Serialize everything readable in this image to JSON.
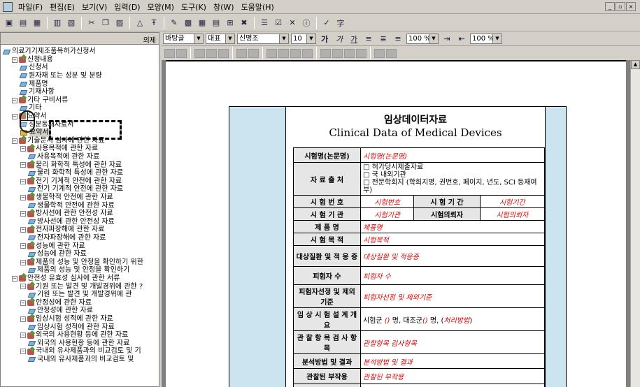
{
  "menu": {
    "items": [
      "파일(F)",
      "편집(E)",
      "보기(V)",
      "입력(D)",
      "모양(M)",
      "도구(K)",
      "창(W)",
      "도움말(H)"
    ],
    "window_buttons": [
      "_",
      "▫",
      "×"
    ]
  },
  "format_bar": {
    "style": "바탕글",
    "size_label": "대표",
    "font": "신명조",
    "font_size": "10",
    "zoom1": "100 %",
    "zoom2": "100 %",
    "bold": "가",
    "italic": "가",
    "underline": "가"
  },
  "left_pane": {
    "header_label": "의제"
  },
  "tree": [
    {
      "level": 0,
      "kind": "page",
      "label": "의료기기제조품목허가신청서"
    },
    {
      "level": 1,
      "kind": "book",
      "label": "신청내용"
    },
    {
      "level": 2,
      "kind": "page",
      "label": "신청서"
    },
    {
      "level": 2,
      "kind": "page",
      "label": "원자재 또는 성분 및 분량"
    },
    {
      "level": 2,
      "kind": "page",
      "label": "제품명"
    },
    {
      "level": 2,
      "kind": "page",
      "label": "기재사항"
    },
    {
      "level": 1,
      "kind": "book",
      "label": "기타 구비서류"
    },
    {
      "level": 2,
      "kind": "page",
      "label": "기타"
    },
    {
      "level": 1,
      "kind": "book",
      "label": "요약서"
    },
    {
      "level": 2,
      "kind": "page",
      "label": "성분동재자료서"
    },
    {
      "level": 2,
      "kind": "folder",
      "label": "요약서"
    },
    {
      "level": 1,
      "kind": "book",
      "label": "기술문서 심사에 관한 자료"
    },
    {
      "level": 2,
      "kind": "book",
      "label": "사용목적에 관한 자료"
    },
    {
      "level": 3,
      "kind": "page",
      "label": "사용목적에 관한 자료"
    },
    {
      "level": 2,
      "kind": "book",
      "label": "물리 화학적 특성에 관한 자료"
    },
    {
      "level": 3,
      "kind": "page",
      "label": "물리 화학적 특성에 관한 자료"
    },
    {
      "level": 2,
      "kind": "book",
      "label": "전기 기계적 안전에 관한 자료"
    },
    {
      "level": 3,
      "kind": "page",
      "label": "전기 기계적 안전에 관한 자료"
    },
    {
      "level": 2,
      "kind": "book",
      "label": "생물학적 안전에 관한 자료"
    },
    {
      "level": 3,
      "kind": "page",
      "label": "생물학적 안전에 관한 자료"
    },
    {
      "level": 2,
      "kind": "book",
      "label": "방사선에 관한 안전성 자료"
    },
    {
      "level": 3,
      "kind": "page",
      "label": "방사선에 관한 안전성 자료"
    },
    {
      "level": 2,
      "kind": "book",
      "label": "전자파장해에 관한 자료"
    },
    {
      "level": 3,
      "kind": "page",
      "label": "전자파장해에 관한 자료"
    },
    {
      "level": 2,
      "kind": "book",
      "label": "성능에 관한 자료"
    },
    {
      "level": 3,
      "kind": "page",
      "label": "성능에 관한 자료"
    },
    {
      "level": 2,
      "kind": "book",
      "label": "제품의 성능 및 안정을 확인하기 위한"
    },
    {
      "level": 3,
      "kind": "page",
      "label": "제품의 성능 및 안정을 확인하기"
    },
    {
      "level": 1,
      "kind": "book",
      "label": "안전성 유효성 심사에 관한 서류"
    },
    {
      "level": 2,
      "kind": "book",
      "label": "기원 또는 발견 및 개발경위에 관한 ?"
    },
    {
      "level": 3,
      "kind": "page",
      "label": "기원 또는 발견 및 개발경위에 관"
    },
    {
      "level": 2,
      "kind": "book",
      "label": "안정성에 관한 자료"
    },
    {
      "level": 3,
      "kind": "page",
      "label": "안정성에 관한 자료"
    },
    {
      "level": 2,
      "kind": "book",
      "label": "임상시험 성적에 관한 자료"
    },
    {
      "level": 3,
      "kind": "page",
      "label": "임상시험 성적에 관한 자료"
    },
    {
      "level": 2,
      "kind": "book",
      "label": "외국의 사용현황 등에 관한 자료"
    },
    {
      "level": 3,
      "kind": "page",
      "label": "외국의 사용현황 등에 관한 자료"
    },
    {
      "level": 2,
      "kind": "book",
      "label": "국내외 유사제품과의 비교검토 및 기"
    },
    {
      "level": 3,
      "kind": "page",
      "label": "국내외 유사제품과의 비교검토 및"
    }
  ],
  "document": {
    "title_ko": "임상데이터자료",
    "title_en": "Clinical Data of Medical Devices",
    "rows": {
      "trial_name_k": "시험명(논문명)",
      "trial_name_v": "시험명(논문명)",
      "source_k": "자 료 출 처",
      "source_opts": [
        "□ 허가당시제출자료",
        "□ 국 내외기관",
        "□ 전문학회지 (학회지명, 권번호, 페이지, 년도, SCI 등재여부)"
      ],
      "trial_no_k": "시 험 번 호",
      "trial_no_v": "시험번호",
      "trial_period_k": "시 험 기 간",
      "trial_period_v": "시험기간",
      "institution_k": "시 험 기 관",
      "institution_v": "시험기관",
      "requester_k": "시험의뢰자",
      "requester_v": "시험의뢰자",
      "product_k": "제 품 명",
      "product_v": "제품명",
      "purpose_k": "시 험 목 적",
      "purpose_v": "시험목적",
      "disease_k": "대상질환 및 적 응 증",
      "disease_v": "대상질환 및 적응증",
      "subjects_k": "피험자 수",
      "subjects_v": "피험자 수",
      "selection_k": "피험자선정 및 제외기준",
      "selection_v": "피험자선정 및 제외기준",
      "design_k": "임 상 시 험 설 계 개 요",
      "design_prefix": "시험군 ",
      "design_a": "()",
      "design_mid": " 명, 대조군",
      "design_b": "()",
      "design_mid2": " 명, (",
      "design_c": "처리방법",
      "design_end": ")",
      "items_k": "관 찰 항 목 검 사 항 목",
      "items_v": "관찰항목 검사항목",
      "analysis_k": "분석방법 및 결과",
      "analysis_v": "분석방법 및 결과",
      "adverse_k": "관찰된 부작용",
      "adverse_v": "관찰된 부작용",
      "conclusion_k": "결론",
      "conclusion_v": "결론"
    }
  }
}
